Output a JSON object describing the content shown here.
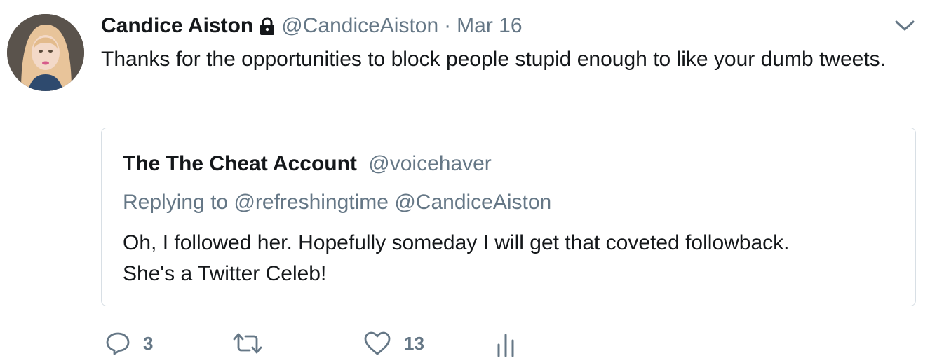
{
  "tweet": {
    "author_name": "Candice Aiston",
    "author_handle": "@CandiceAiston",
    "separator": "·",
    "date": "Mar 16",
    "text": "Thanks for the opportunities to block people stupid enough to like your dumb tweets."
  },
  "quoted_tweet": {
    "author_name": "The The Cheat Account",
    "author_handle": "@voicehaver",
    "replying_prefix": "Replying to",
    "replying_to": [
      "@refreshingtime",
      "@CandiceAiston"
    ],
    "text_line1": "Oh, I followed her. Hopefully someday I will get that coveted followback.",
    "text_line2": "She's a Twitter Celeb!"
  },
  "actions": {
    "reply_count": "3",
    "like_count": "13"
  },
  "icons": {
    "lock": "lock-icon",
    "caret": "chevron-down-icon",
    "reply": "reply-icon",
    "retweet": "retweet-icon",
    "like": "heart-icon",
    "analytics": "analytics-icon"
  },
  "colors": {
    "text": "#14171a",
    "secondary": "#657786",
    "border": "#d8dfe5"
  }
}
